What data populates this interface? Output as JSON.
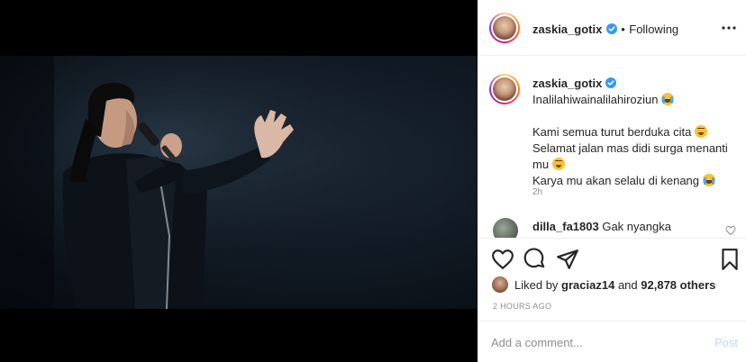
{
  "header": {
    "username": "zaskia_gotix",
    "separator": "•",
    "follow_status": "Following",
    "more_label": "•••"
  },
  "caption": {
    "username": "zaskia_gotix",
    "line1": "Inalilahiwainalilahiroziun",
    "line2": "Kami semua turut berduka cita",
    "line3": "Selamat jalan mas didi surga menanti",
    "line4": "mu",
    "line5": "Karya mu akan selalu di kenang",
    "time": "2h"
  },
  "comment": {
    "username": "dilla_fa1803",
    "text": "Gak nyangka"
  },
  "likes": {
    "prefix": "Liked by",
    "liker": "graciaz14",
    "middle": "and",
    "count": "92,878 others"
  },
  "timestamp": "2 HOURS AGO",
  "add_comment": {
    "placeholder": "Add a comment...",
    "post_label": "Post"
  },
  "icons": [
    "verified-icon",
    "more-icon",
    "heart-icon",
    "comment-icon",
    "share-icon",
    "save-icon",
    "cry-emoji-icon",
    "smile-emoji-icon"
  ],
  "colors": {
    "verified": "#3897f0",
    "post_disabled": "#b2dffc",
    "muted": "#8e8e8e",
    "text": "#262626"
  }
}
